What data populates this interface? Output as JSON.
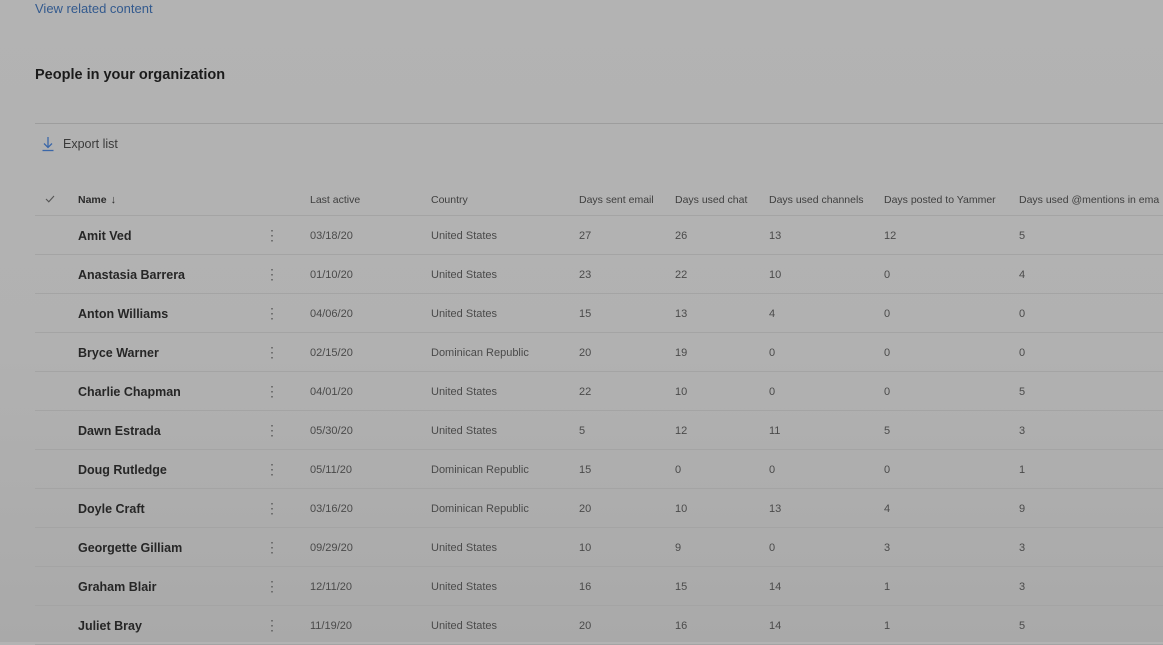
{
  "related_link": "View related content",
  "section_title": "People in your organization",
  "toolbar": {
    "export_label": "Export list",
    "export_icon": "download-icon"
  },
  "table": {
    "select_all_icon": "checkmark-icon",
    "headers": {
      "name": "Name",
      "sort_icon": "↓",
      "last_active": "Last active",
      "country": "Country",
      "days_email": "Days sent email",
      "days_chat": "Days used chat",
      "days_channels": "Days used channels",
      "days_yammer": "Days posted to Yammer",
      "days_mentions": "Days used @mentions in ema"
    },
    "rows": [
      {
        "name": "Amit Ved",
        "last_active": "03/18/20",
        "country": "United States",
        "email": "27",
        "chat": "26",
        "channels": "13",
        "yammer": "12",
        "mentions": "5"
      },
      {
        "name": "Anastasia Barrera",
        "last_active": "01/10/20",
        "country": "United States",
        "email": "23",
        "chat": "22",
        "channels": "10",
        "yammer": "0",
        "mentions": "4"
      },
      {
        "name": "Anton Williams",
        "last_active": "04/06/20",
        "country": "United States",
        "email": "15",
        "chat": "13",
        "channels": "4",
        "yammer": "0",
        "mentions": "0"
      },
      {
        "name": "Bryce Warner",
        "last_active": "02/15/20",
        "country": "Dominican Republic",
        "email": "20",
        "chat": "19",
        "channels": "0",
        "yammer": "0",
        "mentions": "0"
      },
      {
        "name": "Charlie Chapman",
        "last_active": "04/01/20",
        "country": "United States",
        "email": "22",
        "chat": "10",
        "channels": "0",
        "yammer": "0",
        "mentions": "5"
      },
      {
        "name": "Dawn Estrada",
        "last_active": "05/30/20",
        "country": "United States",
        "email": "5",
        "chat": "12",
        "channels": "11",
        "yammer": "5",
        "mentions": "3"
      },
      {
        "name": "Doug Rutledge",
        "last_active": "05/11/20",
        "country": "Dominican Republic",
        "email": "15",
        "chat": "0",
        "channels": "0",
        "yammer": "0",
        "mentions": "1"
      },
      {
        "name": "Doyle Craft",
        "last_active": "03/16/20",
        "country": "Dominican Republic",
        "email": "20",
        "chat": "10",
        "channels": "13",
        "yammer": "4",
        "mentions": "9"
      },
      {
        "name": "Georgette Gilliam",
        "last_active": "09/29/20",
        "country": "United States",
        "email": "10",
        "chat": "9",
        "channels": "0",
        "yammer": "3",
        "mentions": "3"
      },
      {
        "name": "Graham Blair",
        "last_active": "12/11/20",
        "country": "United States",
        "email": "16",
        "chat": "15",
        "channels": "14",
        "yammer": "1",
        "mentions": "3"
      },
      {
        "name": "Juliet Bray",
        "last_active": "11/19/20",
        "country": "United States",
        "email": "20",
        "chat": "16",
        "channels": "14",
        "yammer": "1",
        "mentions": "5"
      }
    ]
  }
}
